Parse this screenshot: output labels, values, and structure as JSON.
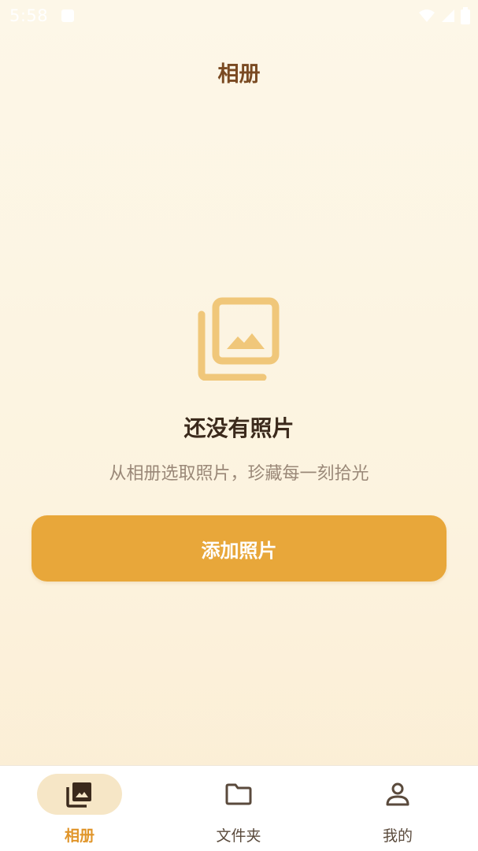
{
  "status_bar": {
    "time": "5:58"
  },
  "header": {
    "title": "相册"
  },
  "empty_state": {
    "icon": "photo-library-icon",
    "title": "还没有照片",
    "subtitle": "从相册选取照片，珍藏每一刻拾光"
  },
  "actions": {
    "add_photo_label": "添加照片"
  },
  "bottom_nav": {
    "items": [
      {
        "label": "相册",
        "icon": "photo-library-icon",
        "active": true
      },
      {
        "label": "文件夹",
        "icon": "folder-icon",
        "active": false
      },
      {
        "label": "我的",
        "icon": "person-icon",
        "active": false
      }
    ]
  },
  "colors": {
    "accent": "#e8a73a",
    "title": "#7a4a22",
    "nav_active_bg": "#f6e6c6",
    "nav_active_text": "#e0952a",
    "icon_light": "#f0c77a"
  }
}
